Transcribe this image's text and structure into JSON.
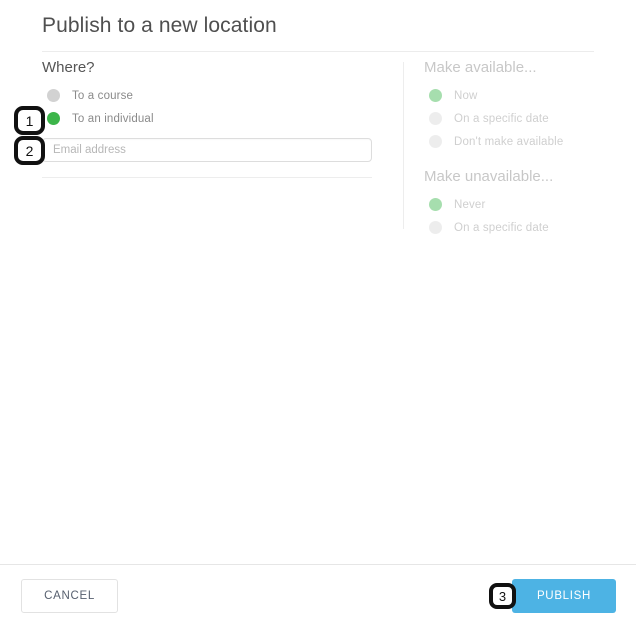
{
  "dialog": {
    "title": "Publish to a new location"
  },
  "left_panel": {
    "heading": "Where?",
    "options": [
      {
        "label": "To a course",
        "selected": false
      },
      {
        "label": "To an individual",
        "selected": true
      }
    ],
    "email_field": {
      "value": "",
      "placeholder": "Email address"
    }
  },
  "right_panel": {
    "available": {
      "heading": "Make available...",
      "options": [
        {
          "label": "Now",
          "selected": true
        },
        {
          "label": "On a specific date",
          "selected": false
        },
        {
          "label": "Don't make available",
          "selected": false
        }
      ]
    },
    "unavailable": {
      "heading": "Make unavailable...",
      "options": [
        {
          "label": "Never",
          "selected": true
        },
        {
          "label": "On a specific date",
          "selected": false
        }
      ]
    }
  },
  "footer": {
    "cancel_label": "CANCEL",
    "publish_label": "PUBLISH"
  },
  "annotations": [
    {
      "number": "1"
    },
    {
      "number": "2"
    },
    {
      "number": "3"
    }
  ],
  "colors": {
    "accent_blue": "#4db3e4",
    "radio_green": "#3cb54a",
    "radio_gray": "#d2d2d2",
    "text_gray": "#8a8a8a",
    "title_gray": "#4f4f4f",
    "badge_black": "#111111"
  }
}
